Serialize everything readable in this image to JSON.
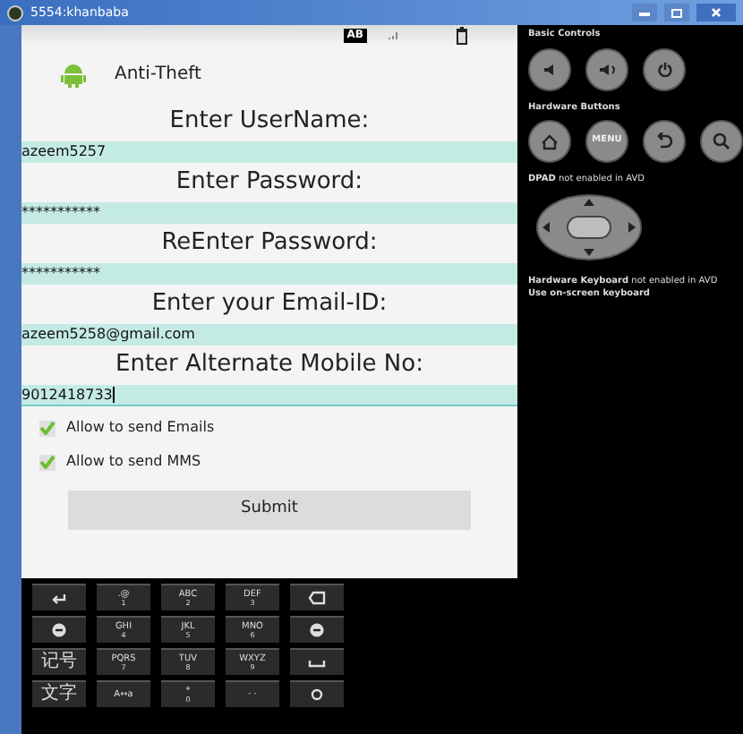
{
  "window": {
    "title": "5554:khanbaba"
  },
  "status_bar": {
    "badge": "AB"
  },
  "app": {
    "title": "Anti-Theft"
  },
  "form": [
    {
      "label": "Enter UserName:",
      "value": "azeem5257",
      "focused": false
    },
    {
      "label": "Enter Password:",
      "value": "***********",
      "focused": false
    },
    {
      "label": "ReEnter Password:",
      "value": "***********",
      "focused": false
    },
    {
      "label": "Enter your Email-ID:",
      "value": "azeem5258@gmail.com",
      "focused": false
    },
    {
      "label": "Enter Alternate Mobile No:",
      "value": "9012418733",
      "focused": true
    }
  ],
  "options": [
    {
      "label": "Allow to send Emails",
      "checked": true
    },
    {
      "label": "Allow to send MMS",
      "checked": true
    }
  ],
  "submit": "Submit",
  "keypad": [
    [
      {
        "kind": "icon"
      },
      {
        "kind": "text",
        "main": ".@",
        "sub": "1"
      },
      {
        "kind": "text",
        "main": "ABC",
        "sub": "2"
      },
      {
        "kind": "text",
        "main": "DEF",
        "sub": "3"
      },
      {
        "kind": "icon"
      }
    ],
    [
      {
        "kind": "icon"
      },
      {
        "kind": "text",
        "main": "GHI",
        "sub": "4"
      },
      {
        "kind": "text",
        "main": "JKL",
        "sub": "5"
      },
      {
        "kind": "text",
        "main": "MNO",
        "sub": "6"
      },
      {
        "kind": "icon"
      }
    ],
    [
      {
        "kind": "cjk",
        "main": "记号"
      },
      {
        "kind": "text",
        "main": "PQRS",
        "sub": "7"
      },
      {
        "kind": "text",
        "main": "TUV",
        "sub": "8"
      },
      {
        "kind": "text",
        "main": "WXYZ",
        "sub": "9"
      },
      {
        "kind": "icon"
      }
    ],
    [
      {
        "kind": "cjk",
        "main": "文字"
      },
      {
        "kind": "text",
        "main": "A↔a"
      },
      {
        "kind": "text",
        "main": "*",
        "sub": "0"
      },
      {
        "kind": "text",
        "main": "· ·"
      },
      {
        "kind": "icon"
      }
    ]
  ],
  "controls": {
    "basic_title": "Basic Controls",
    "hardware_title": "Hardware Buttons",
    "menu_label": "MENU",
    "dpad_title": "DPAD",
    "dpad_note": "not enabled in AVD",
    "keyboard_title": "Hardware Keyboard",
    "keyboard_note": "not enabled in AVD",
    "keyboard_hint": "Use on-screen keyboard"
  }
}
